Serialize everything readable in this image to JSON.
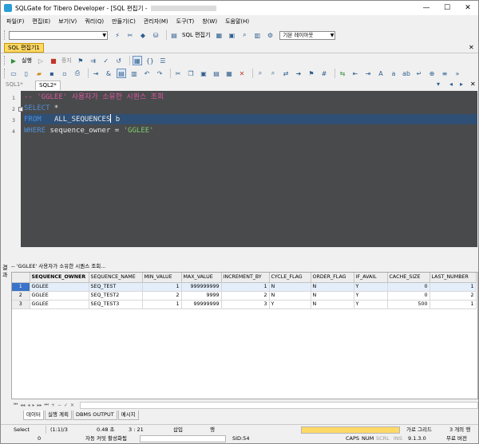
{
  "window": {
    "title": "SQLGate for Tibero Developer - [SQL 편집기 -",
    "minimize": "—",
    "maximize": "☐",
    "close": "✕"
  },
  "menu": [
    "파일(F)",
    "편집(E)",
    "보기(V)",
    "쿼리(Q)",
    "만들기(C)",
    "관리자(M)",
    "도구(T)",
    "창(W)",
    "도움말(H)"
  ],
  "toolbar1": {
    "sql_editor_label": "SQL 편집기",
    "layout_combo": "기본 레이아웃"
  },
  "doc_tab": "SQL 편집기1",
  "toolbar3": {
    "run_label": "실행",
    "stop_label": "중지"
  },
  "editor_tabs": [
    "SQL1*",
    "SQL2*"
  ],
  "editor": {
    "line_numbers": [
      "1",
      "2",
      "3",
      "4"
    ],
    "comment": "-- 'GGLEE' 사용자가 소유한 시퀀스 조회",
    "select_kw": "SELECT",
    "select_rest": " *",
    "from_kw": "FROM",
    "from_rest": "   ALL_SEQUENCES",
    "from_alias": " b",
    "where_kw": "WHERE",
    "where_rest": " sequence_owner = ",
    "where_value": "'GGLEE'"
  },
  "result": {
    "side_label_1": "결",
    "side_label_2": "과",
    "header": "-- 'GGLEE' 사용자가 소유한 시퀀스 조회...",
    "columns": [
      "SEQUENCE_OWNER",
      "SEQUENCE_NAME",
      "MIN_VALUE",
      "MAX_VALUE",
      "INCREMENT_BY",
      "CYCLE_FLAG",
      "ORDER_FLAG",
      "IF_AVAIL",
      "CACHE_SIZE",
      "LAST_NUMBER"
    ],
    "rows": [
      {
        "n": "1",
        "cells": [
          "GGLEE",
          "SEQ_TEST",
          "1",
          "999999999",
          "1",
          "N",
          "N",
          "Y",
          "0",
          "1"
        ]
      },
      {
        "n": "2",
        "cells": [
          "GGLEE",
          "SEQ_TEST2",
          "2",
          "9999",
          "2",
          "N",
          "N",
          "Y",
          "0",
          "2"
        ]
      },
      {
        "n": "3",
        "cells": [
          "GGLEE",
          "SEQ_TEST3",
          "1",
          "99999999",
          "3",
          "Y",
          "N",
          "Y",
          "500",
          "1"
        ]
      }
    ]
  },
  "bottom_tabs": [
    "데이터",
    "실행 계획",
    "DBMS OUTPUT",
    "메시지"
  ],
  "status1": {
    "select": "Select",
    "position": "(1:1)/3",
    "time": "0.48 초",
    "cursor": "3 : 21",
    "insert_mode": "삽입",
    "edit_mode": "행",
    "grid_mode": "가로 그리드",
    "count": "3 개의 행"
  },
  "status2": {
    "zero": "0",
    "autocommit": "자동 커밋 활성화됨",
    "sid": "SID:54",
    "caps": "CAPS",
    "num": "NUM",
    "scrl": "SCRL",
    "ins": "INS",
    "version": "9.1.3.0",
    "free": "무료 버전"
  }
}
